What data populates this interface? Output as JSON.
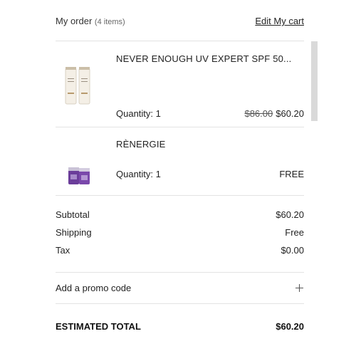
{
  "header": {
    "title": "My order",
    "count": "(4 items)",
    "edit_link": "Edit My cart"
  },
  "items": [
    {
      "name": "NEVER ENOUGH UV EXPERT SPF 50...",
      "quantity": "Quantity: 1",
      "original_price": "$86.00",
      "price": "$60.20",
      "thumb_icon": "sunscreen-tubes-image"
    },
    {
      "name": "RÈNERGIE",
      "quantity": "Quantity: 1",
      "price": "FREE",
      "thumb_icon": "purple-cream-jars-image"
    }
  ],
  "summary": {
    "subtotal_label": "Subtotal",
    "subtotal_value": "$60.20",
    "shipping_label": "Shipping",
    "shipping_value": "Free",
    "tax_label": "Tax",
    "tax_value": "$0.00"
  },
  "promo": {
    "label": "Add a promo code"
  },
  "total": {
    "label": "ESTIMATED TOTAL",
    "value": "$60.20"
  }
}
